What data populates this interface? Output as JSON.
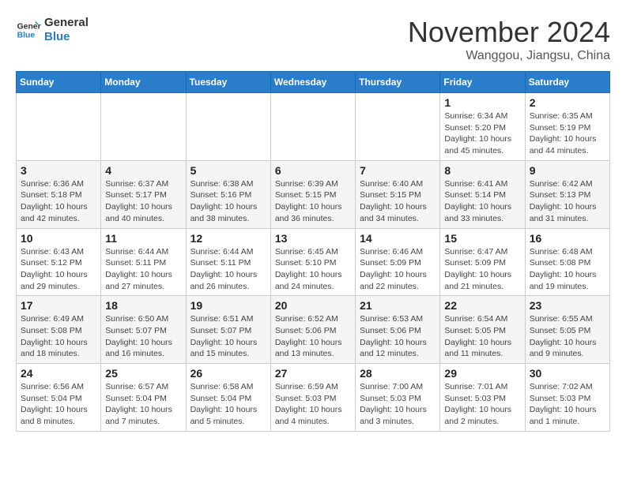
{
  "logo": {
    "line1": "General",
    "line2": "Blue"
  },
  "title": "November 2024",
  "location": "Wanggou, Jiangsu, China",
  "weekdays": [
    "Sunday",
    "Monday",
    "Tuesday",
    "Wednesday",
    "Thursday",
    "Friday",
    "Saturday"
  ],
  "weeks": [
    [
      {
        "day": "",
        "info": ""
      },
      {
        "day": "",
        "info": ""
      },
      {
        "day": "",
        "info": ""
      },
      {
        "day": "",
        "info": ""
      },
      {
        "day": "",
        "info": ""
      },
      {
        "day": "1",
        "info": "Sunrise: 6:34 AM\nSunset: 5:20 PM\nDaylight: 10 hours and 45 minutes."
      },
      {
        "day": "2",
        "info": "Sunrise: 6:35 AM\nSunset: 5:19 PM\nDaylight: 10 hours and 44 minutes."
      }
    ],
    [
      {
        "day": "3",
        "info": "Sunrise: 6:36 AM\nSunset: 5:18 PM\nDaylight: 10 hours and 42 minutes."
      },
      {
        "day": "4",
        "info": "Sunrise: 6:37 AM\nSunset: 5:17 PM\nDaylight: 10 hours and 40 minutes."
      },
      {
        "day": "5",
        "info": "Sunrise: 6:38 AM\nSunset: 5:16 PM\nDaylight: 10 hours and 38 minutes."
      },
      {
        "day": "6",
        "info": "Sunrise: 6:39 AM\nSunset: 5:15 PM\nDaylight: 10 hours and 36 minutes."
      },
      {
        "day": "7",
        "info": "Sunrise: 6:40 AM\nSunset: 5:15 PM\nDaylight: 10 hours and 34 minutes."
      },
      {
        "day": "8",
        "info": "Sunrise: 6:41 AM\nSunset: 5:14 PM\nDaylight: 10 hours and 33 minutes."
      },
      {
        "day": "9",
        "info": "Sunrise: 6:42 AM\nSunset: 5:13 PM\nDaylight: 10 hours and 31 minutes."
      }
    ],
    [
      {
        "day": "10",
        "info": "Sunrise: 6:43 AM\nSunset: 5:12 PM\nDaylight: 10 hours and 29 minutes."
      },
      {
        "day": "11",
        "info": "Sunrise: 6:44 AM\nSunset: 5:11 PM\nDaylight: 10 hours and 27 minutes."
      },
      {
        "day": "12",
        "info": "Sunrise: 6:44 AM\nSunset: 5:11 PM\nDaylight: 10 hours and 26 minutes."
      },
      {
        "day": "13",
        "info": "Sunrise: 6:45 AM\nSunset: 5:10 PM\nDaylight: 10 hours and 24 minutes."
      },
      {
        "day": "14",
        "info": "Sunrise: 6:46 AM\nSunset: 5:09 PM\nDaylight: 10 hours and 22 minutes."
      },
      {
        "day": "15",
        "info": "Sunrise: 6:47 AM\nSunset: 5:09 PM\nDaylight: 10 hours and 21 minutes."
      },
      {
        "day": "16",
        "info": "Sunrise: 6:48 AM\nSunset: 5:08 PM\nDaylight: 10 hours and 19 minutes."
      }
    ],
    [
      {
        "day": "17",
        "info": "Sunrise: 6:49 AM\nSunset: 5:08 PM\nDaylight: 10 hours and 18 minutes."
      },
      {
        "day": "18",
        "info": "Sunrise: 6:50 AM\nSunset: 5:07 PM\nDaylight: 10 hours and 16 minutes."
      },
      {
        "day": "19",
        "info": "Sunrise: 6:51 AM\nSunset: 5:07 PM\nDaylight: 10 hours and 15 minutes."
      },
      {
        "day": "20",
        "info": "Sunrise: 6:52 AM\nSunset: 5:06 PM\nDaylight: 10 hours and 13 minutes."
      },
      {
        "day": "21",
        "info": "Sunrise: 6:53 AM\nSunset: 5:06 PM\nDaylight: 10 hours and 12 minutes."
      },
      {
        "day": "22",
        "info": "Sunrise: 6:54 AM\nSunset: 5:05 PM\nDaylight: 10 hours and 11 minutes."
      },
      {
        "day": "23",
        "info": "Sunrise: 6:55 AM\nSunset: 5:05 PM\nDaylight: 10 hours and 9 minutes."
      }
    ],
    [
      {
        "day": "24",
        "info": "Sunrise: 6:56 AM\nSunset: 5:04 PM\nDaylight: 10 hours and 8 minutes."
      },
      {
        "day": "25",
        "info": "Sunrise: 6:57 AM\nSunset: 5:04 PM\nDaylight: 10 hours and 7 minutes."
      },
      {
        "day": "26",
        "info": "Sunrise: 6:58 AM\nSunset: 5:04 PM\nDaylight: 10 hours and 5 minutes."
      },
      {
        "day": "27",
        "info": "Sunrise: 6:59 AM\nSunset: 5:03 PM\nDaylight: 10 hours and 4 minutes."
      },
      {
        "day": "28",
        "info": "Sunrise: 7:00 AM\nSunset: 5:03 PM\nDaylight: 10 hours and 3 minutes."
      },
      {
        "day": "29",
        "info": "Sunrise: 7:01 AM\nSunset: 5:03 PM\nDaylight: 10 hours and 2 minutes."
      },
      {
        "day": "30",
        "info": "Sunrise: 7:02 AM\nSunset: 5:03 PM\nDaylight: 10 hours and 1 minute."
      }
    ]
  ]
}
